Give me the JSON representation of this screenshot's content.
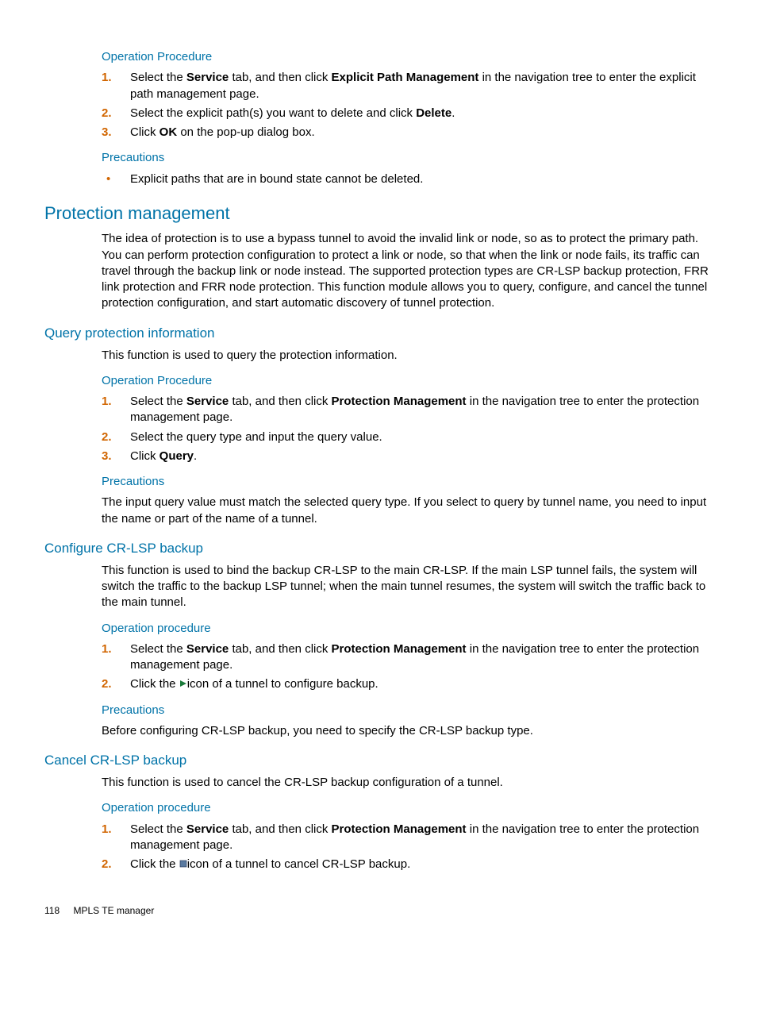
{
  "section0": {
    "op_heading": "Operation Procedure",
    "steps": {
      "s1_a": "Select the ",
      "s1_b": "Service",
      "s1_c": " tab, and then click ",
      "s1_d": "Explicit Path Management",
      "s1_e": " in the navigation tree to enter the explicit path management page.",
      "s2_a": "Select the explicit path(s) you want to delete and click ",
      "s2_b": "Delete",
      "s2_c": ".",
      "s3_a": "Click ",
      "s3_b": "OK",
      "s3_c": " on the pop-up dialog box."
    },
    "prec_heading": "Precautions",
    "prec_item": "Explicit paths that are in bound state cannot be deleted."
  },
  "protection": {
    "heading": "Protection management",
    "intro": "The idea of protection is to use a bypass tunnel to avoid the invalid link or node, so as to protect the primary path. You can perform protection configuration to protect a link or node, so that when the link or node fails, its traffic can travel through the backup link or node instead. The supported protection types are CR-LSP backup protection, FRR link protection and FRR node protection. This function module allows you to query, configure, and cancel the tunnel protection configuration, and start automatic discovery of tunnel protection."
  },
  "query": {
    "heading": "Query protection information",
    "intro": "This function is used to query the protection information.",
    "op_heading": "Operation Procedure",
    "steps": {
      "s1_a": "Select the ",
      "s1_b": "Service",
      "s1_c": " tab, and then click ",
      "s1_d": "Protection Management",
      "s1_e": " in the navigation tree to enter the protection management page.",
      "s2": "Select the query type and input the query value.",
      "s3_a": "Click ",
      "s3_b": "Query",
      "s3_c": "."
    },
    "prec_heading": "Precautions",
    "prec_text": "The input query value must match the selected query type. If you select to query by tunnel name, you need to input the name or part of the name of a tunnel."
  },
  "configure": {
    "heading": "Configure CR-LSP backup",
    "intro": "This function is used to bind the backup CR-LSP to the main CR-LSP. If the main LSP tunnel fails, the system will switch the traffic to the backup LSP tunnel; when the main tunnel resumes, the system will switch the traffic back to the main tunnel.",
    "op_heading": "Operation procedure",
    "steps": {
      "s1_a": "Select the ",
      "s1_b": "Service",
      "s1_c": " tab, and then click ",
      "s1_d": "Protection Management",
      "s1_e": " in the navigation tree to enter the protection management page.",
      "s2_a": "Click the ",
      "s2_b": "icon of a tunnel to configure backup."
    },
    "prec_heading": "Precautions",
    "prec_text": "Before configuring CR-LSP backup, you need to specify the CR-LSP backup type."
  },
  "cancel": {
    "heading": "Cancel CR-LSP backup",
    "intro": "This function is used to cancel the CR-LSP backup configuration of a tunnel.",
    "op_heading": "Operation procedure",
    "steps": {
      "s1_a": "Select the ",
      "s1_b": "Service",
      "s1_c": " tab, and then click ",
      "s1_d": "Protection Management",
      "s1_e": " in the navigation tree to enter the protection management page.",
      "s2_a": "Click the ",
      "s2_b": "icon of a tunnel to cancel CR-LSP backup."
    }
  },
  "footer": {
    "page": "118",
    "title": "MPLS TE manager"
  }
}
